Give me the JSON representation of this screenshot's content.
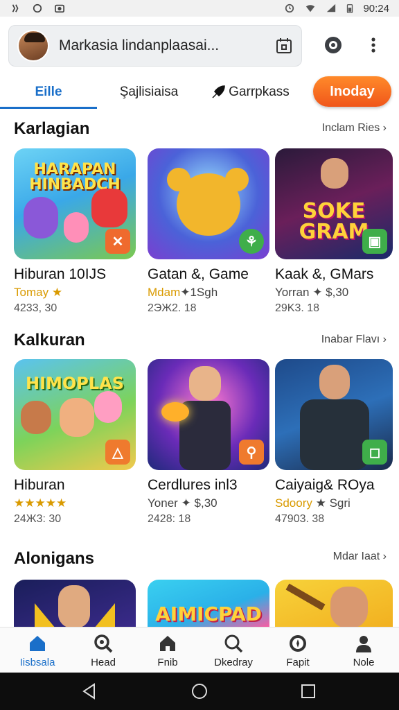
{
  "status": {
    "time": "90:24"
  },
  "search": {
    "text": "Markasia lindanplaasai..."
  },
  "tabs": [
    {
      "label": "Eille"
    },
    {
      "label": "Şajlisiaisa"
    },
    {
      "label": "Garrpkass"
    }
  ],
  "tab_pill": {
    "label": "Inoday"
  },
  "sections": [
    {
      "title": "Karlagian",
      "link": "Inclam Ries",
      "cards": [
        {
          "art": "HARAPAN HINBADCH",
          "title": "Hiburan 10IJS",
          "sub": "Tomay",
          "sub_extra": "★",
          "meta": "4233, 30"
        },
        {
          "art": "",
          "title": "Gatan &, Game",
          "sub": "Mdam",
          "sub_extra": "✦1Sgh",
          "meta": "2ЭЖ2. 18"
        },
        {
          "art": "SOKE GRAM",
          "title": "Kaak &, GMars",
          "sub": "Yorran",
          "sub_extra": "✦ $,30",
          "meta": "29K3. 18"
        }
      ]
    },
    {
      "title": "Kalkuran",
      "link": "Inabar Flavı",
      "cards": [
        {
          "art": "HIMOPLAS",
          "title": "Hiburan",
          "sub": "★★★★★",
          "sub_extra": "",
          "meta": "24Ж3: 30"
        },
        {
          "art": "",
          "title": "Cerdlures inl3",
          "sub": "Yoner",
          "sub_extra": "✦ $,30",
          "meta": "2428: 18"
        },
        {
          "art": "",
          "title": "Caiyaig& ROya",
          "sub": "Sdoory",
          "sub_extra": "★ Sgri",
          "meta": "47903. 38"
        }
      ]
    },
    {
      "title": "Alonigans",
      "link": "Mdar Iaat",
      "cards": [
        {
          "art": ""
        },
        {
          "art": "AIMICPAD"
        },
        {
          "art": ""
        }
      ]
    }
  ],
  "bottom_nav": [
    {
      "label": "Iisbsala",
      "icon": "home-icon"
    },
    {
      "label": "Head",
      "icon": "search-icon"
    },
    {
      "label": "Fnib",
      "icon": "house-icon"
    },
    {
      "label": "Dkedray",
      "icon": "magnifier-icon"
    },
    {
      "label": "Fapit",
      "icon": "compass-icon"
    },
    {
      "label": "Nole",
      "icon": "profile-icon"
    }
  ],
  "colors": {
    "accent": "#1a6fc9",
    "pill": "#f0561a",
    "star": "#d99a00"
  }
}
